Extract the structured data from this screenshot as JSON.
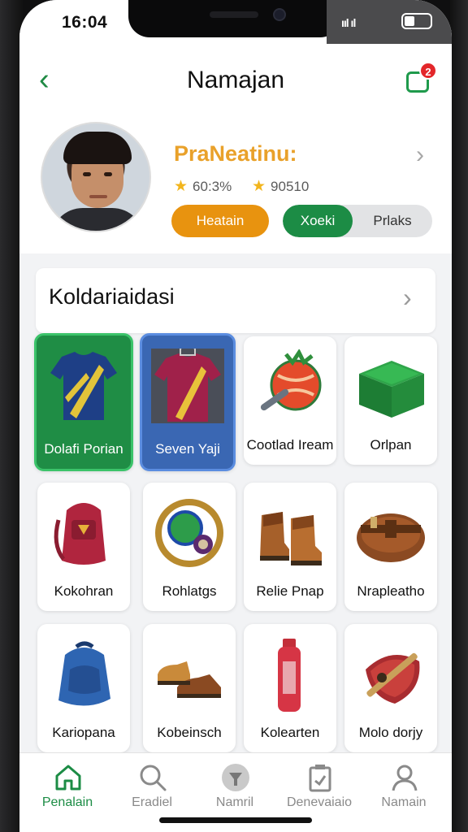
{
  "status": {
    "time": "16:04",
    "signal": "ııl ıl"
  },
  "header": {
    "title": "Namajan",
    "cart_badge": "2"
  },
  "profile": {
    "name": "PraNeatinu:",
    "stat1": "60:3%",
    "stat2": "90510",
    "button_orange": "Heatain",
    "toggle_on": "Xoeki",
    "toggle_off": "Prlaks"
  },
  "section": {
    "title": "Koldariaidasi"
  },
  "tiles": [
    {
      "label": "Dolafi Porian",
      "icon": "jersey-blue-icon"
    },
    {
      "label": "Seven Yaji",
      "icon": "jersey-red-icon"
    },
    {
      "label": "Cootlad Iream",
      "icon": "mace-ball-icon"
    },
    {
      "label": "Orlpan",
      "icon": "green-crate-icon"
    },
    {
      "label": "Kokohran",
      "icon": "red-backpack-icon"
    },
    {
      "label": "Rohlatgs",
      "icon": "magic-orb-icon"
    },
    {
      "label": "Relie Pnap",
      "icon": "boots-icon"
    },
    {
      "label": "Nrapleatho",
      "icon": "leather-armor-icon"
    },
    {
      "label": "Kariopana",
      "icon": "blue-backpack-icon"
    },
    {
      "label": "Kobeinsch",
      "icon": "shoes-icon"
    },
    {
      "label": "Kolearten",
      "icon": "bottle-icon"
    },
    {
      "label": "Molo dorjy",
      "icon": "shield-sword-icon"
    }
  ],
  "nav": [
    {
      "label": "Penalain",
      "icon": "home-icon"
    },
    {
      "label": "Eradiel",
      "icon": "search-icon"
    },
    {
      "label": "Namril",
      "icon": "filter-icon"
    },
    {
      "label": "Denevaiaio",
      "icon": "clipboard-icon"
    },
    {
      "label": "Namain",
      "icon": "user-icon"
    }
  ],
  "colors": {
    "accent": "#1c8c45",
    "orange": "#e8930f",
    "badge": "#e3262a"
  }
}
